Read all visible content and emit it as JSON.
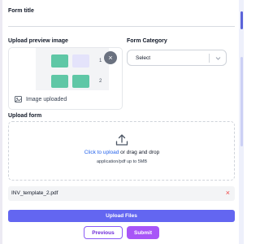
{
  "form_title": {
    "label": "Form title",
    "value": ""
  },
  "preview": {
    "label": "Upload preview image",
    "pages": [
      "1",
      "2"
    ],
    "status_text": "Image uploaded",
    "remove_symbol": "×"
  },
  "category": {
    "label": "Form Category",
    "selected": "Select"
  },
  "upload_form": {
    "label": "Upload form",
    "link_text": "Click to upload",
    "rest_text": " or drag and drop",
    "hint": "application/pdf up to 5MB"
  },
  "file": {
    "name": "INV_template_2.pdf",
    "remove_symbol": "×"
  },
  "buttons": {
    "upload": "Upload Files",
    "previous": "Previous",
    "submit": "Submit"
  },
  "colors": {
    "primary": "#6366f1",
    "submit": "#a855f7",
    "link": "#2563eb",
    "thumb_green": "#5fc7a6",
    "thumb_lilac": "#e4e3fb",
    "remove_red": "#ef4444"
  }
}
